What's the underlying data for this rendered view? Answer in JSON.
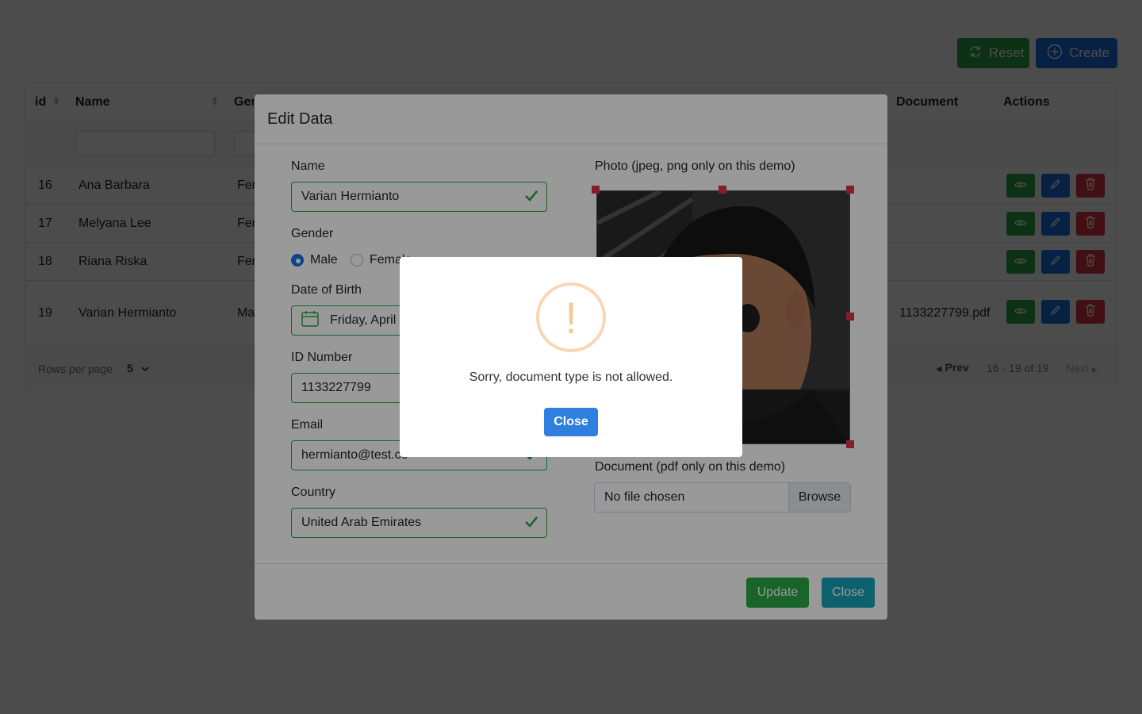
{
  "toolbar": {
    "reset_label": "Reset",
    "create_label": "Create"
  },
  "table": {
    "headers": {
      "id": "id",
      "name": "Name",
      "gender": "Gen",
      "document": "Document",
      "actions": "Actions"
    },
    "rows": [
      {
        "id": "16",
        "name": "Ana Barbara",
        "gender": "Fer",
        "document": ""
      },
      {
        "id": "17",
        "name": "Melyana Lee",
        "gender": "Fer",
        "document": ""
      },
      {
        "id": "18",
        "name": "Riana Riska",
        "gender": "Fer",
        "document": ""
      },
      {
        "id": "19",
        "name": "Varian Hermianto",
        "gender": "Ma",
        "document": "1133227799.pdf"
      }
    ],
    "footer": {
      "rows_per_page_label": "Rows per page",
      "rows_per_page_value": "5",
      "prev_label": "Prev",
      "range_label": "16 - 19 of 19",
      "next_label": "Next"
    }
  },
  "modal": {
    "title": "Edit Data",
    "name_label": "Name",
    "name_value": "Varian Hermianto",
    "gender_label": "Gender",
    "gender_male": "Male",
    "gender_female": "Female",
    "dob_label": "Date of Birth",
    "dob_value": "Friday, April",
    "id_label": "ID Number",
    "id_value": "1133227799",
    "email_label": "Email",
    "email_value": "hermianto@test.co",
    "country_label": "Country",
    "country_value": "United Arab Emirates",
    "photo_label": "Photo (jpeg, png only on this demo)",
    "document_label": "Document (pdf only on this demo)",
    "file_placeholder": "No file chosen",
    "browse_label": "Browse",
    "update_label": "Update",
    "close_label": "Close"
  },
  "alert": {
    "icon": "!",
    "message": "Sorry, document type is not allowed.",
    "close_label": "Close"
  },
  "colors": {
    "success": "#28a745",
    "primary": "#1a6fe8",
    "danger": "#dc3545",
    "info": "#17a2b8",
    "warning_icon": "#f8d7b5"
  }
}
